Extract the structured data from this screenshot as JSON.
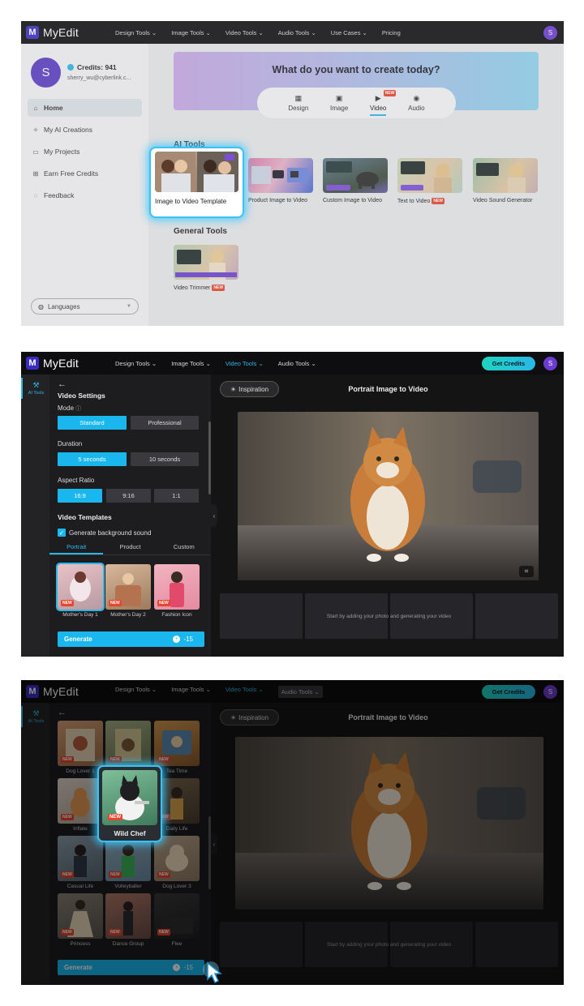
{
  "brand": {
    "name": "MyEdit",
    "avatar_letter": "S",
    "accent": "#2ab7e8"
  },
  "nav": {
    "design_tools": "Design Tools",
    "image_tools": "Image Tools",
    "video_tools": "Video Tools",
    "audio_tools": "Audio Tools",
    "use_cases": "Use Cases",
    "pricing": "Pricing",
    "get_credits": "Get Credits"
  },
  "home": {
    "user": {
      "avatar_letter": "S",
      "credits": "Credits: 941",
      "email": "sherry_wu@cyberlink.c..."
    },
    "menu": [
      {
        "label": "Home",
        "icon": "home-icon"
      },
      {
        "label": "My AI Creations",
        "icon": "sparkle-icon"
      },
      {
        "label": "My Projects",
        "icon": "folder-icon"
      },
      {
        "label": "Earn Free Credits",
        "icon": "gift-icon"
      },
      {
        "label": "Feedback",
        "icon": "feedback-icon"
      }
    ],
    "languages": "Languages",
    "hero_title": "What do you want to create today?",
    "hero_tabs": [
      "Design",
      "Image",
      "Video",
      "Audio"
    ],
    "new_badge": "NEW",
    "ai_tools_title": "AI Tools",
    "ai_tools": [
      {
        "label": "Image to Video Template"
      },
      {
        "label": "Product Image to Video"
      },
      {
        "label": "Custom Image to Video"
      },
      {
        "label": "Text to Video"
      },
      {
        "label": "Video Sound Generator"
      }
    ],
    "general_tools_title": "General Tools",
    "general_tools": [
      {
        "label": "Video Trimmer"
      }
    ]
  },
  "editor": {
    "rail_label": "AI Tools",
    "settings_title": "Video Settings",
    "mode_label": "Mode",
    "modes": [
      "Standard",
      "Professional"
    ],
    "duration_label": "Duration",
    "durations": [
      "5 seconds",
      "10 seconds"
    ],
    "aspect_label": "Aspect Ratio",
    "aspects": [
      "16:9",
      "9:16",
      "1:1"
    ],
    "templates_label": "Video Templates",
    "bg_sound_label": "Generate background sound",
    "template_tabs": [
      "Portrait",
      "Product",
      "Custom"
    ],
    "templates_p2": [
      "Mother's Day 1",
      "Mother's Day 2",
      "Fashion Icon"
    ],
    "templates_p3": [
      "Dog Lover 1",
      "",
      "Tea Time",
      "Inflate",
      "Wild Chef",
      "Daily Life",
      "Casual Life",
      "Volleyballer",
      "Dog Lover 3",
      "Princess",
      "Dance Group",
      "Flee"
    ],
    "generate": "Generate",
    "cost": "-15",
    "inspiration": "Inspiration",
    "title": "Portrait Image to Video",
    "slot_hint": "Start by adding your photo and generating your video",
    "highlight": "Wild Chef"
  }
}
